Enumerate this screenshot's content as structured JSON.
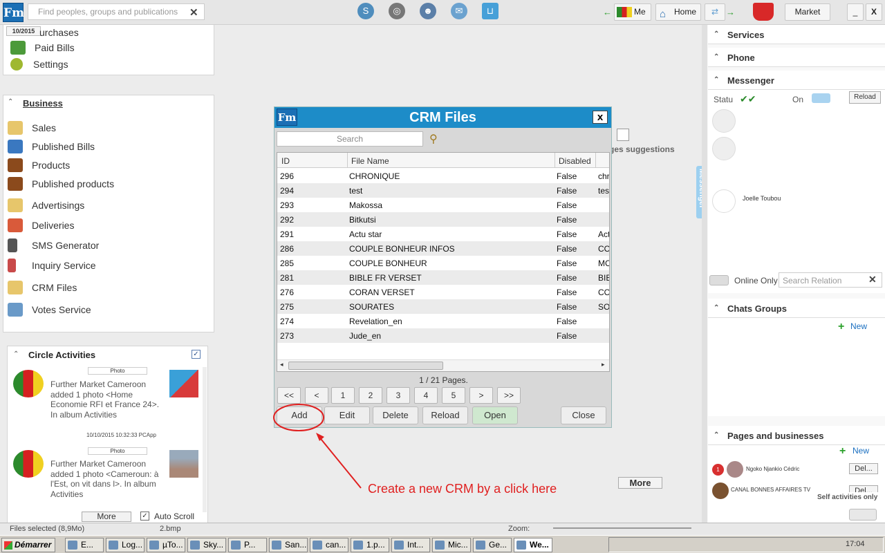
{
  "topbar": {
    "search_placeholder": "Find peoples, groups and publications",
    "me_label": "Me",
    "home_label": "Home",
    "market_label": "Market",
    "minimize_label": "_",
    "close_label": "X",
    "date_badge": "10/2015"
  },
  "left_top_menu": {
    "items": [
      {
        "label": "urchases"
      },
      {
        "label": "Paid Bills"
      },
      {
        "label": "Settings"
      }
    ]
  },
  "business": {
    "title": "Business",
    "items": [
      {
        "label": "Sales"
      },
      {
        "label": "Published Bills"
      },
      {
        "label": "Products"
      },
      {
        "label": "Published products"
      },
      {
        "label": "Advertisings"
      },
      {
        "label": "Deliveries"
      },
      {
        "label": "SMS Generator"
      },
      {
        "label": "Inquiry Service"
      },
      {
        "label": "CRM Files"
      },
      {
        "label": "Votes Service"
      }
    ]
  },
  "circle": {
    "title": "Circle Activities",
    "posts": [
      {
        "tag": "Photo",
        "text": "Further Market Cameroon added 1 photo <Home Economie RFI et France 24>. In album Activities",
        "time": "10/10/2015 10:32:33 PCApp"
      },
      {
        "tag": "Photo",
        "text": "Further Market Cameroon added 1 photo <Cameroun: à l'Est, on vit dans l>. In album Activities"
      }
    ],
    "more_label": "More",
    "autoscroll_label": "Auto Scroll"
  },
  "center": {
    "suggestions_label": "ges suggestions",
    "more_label": "More",
    "annotation": "Create a new CRM by a click here",
    "messenger_tab": "Messenger"
  },
  "crm": {
    "title": "CRM Files",
    "close_x": "x",
    "search_placeholder": "Search",
    "columns": [
      "ID",
      "File Name",
      "Disabled"
    ],
    "rows": [
      {
        "id": "296",
        "name": "CHRONIQUE",
        "disabled": "False",
        "extra": "chr"
      },
      {
        "id": "294",
        "name": "test",
        "disabled": "False",
        "extra": "tes"
      },
      {
        "id": "293",
        "name": "Makossa",
        "disabled": "False",
        "extra": ""
      },
      {
        "id": "292",
        "name": "Bitkutsi",
        "disabled": "False",
        "extra": ""
      },
      {
        "id": "291",
        "name": "Actu star",
        "disabled": "False",
        "extra": "Act"
      },
      {
        "id": "286",
        "name": "COUPLE BONHEUR INFOS",
        "disabled": "False",
        "extra": "CO"
      },
      {
        "id": "285",
        "name": "COUPLE BONHEUR",
        "disabled": "False",
        "extra": "MC"
      },
      {
        "id": "281",
        "name": "BIBLE FR VERSET",
        "disabled": "False",
        "extra": "BIB"
      },
      {
        "id": "276",
        "name": "CORAN VERSET",
        "disabled": "False",
        "extra": "CO"
      },
      {
        "id": "275",
        "name": "SOURATES",
        "disabled": "False",
        "extra": "SO"
      },
      {
        "id": "274",
        "name": "Revelation_en",
        "disabled": "False",
        "extra": ""
      },
      {
        "id": "273",
        "name": "Jude_en",
        "disabled": "False",
        "extra": ""
      }
    ],
    "page_info": "1 / 21 Pages.",
    "pager": [
      "<<",
      "<",
      "1",
      "2",
      "3",
      "4",
      "5",
      ">",
      ">>"
    ],
    "add_label": "Add",
    "edit_label": "Edit",
    "delete_label": "Delete",
    "reload_label": "Reload",
    "open_label": "Open",
    "close_label": "Close"
  },
  "right": {
    "services": "Services",
    "phone": "Phone",
    "messenger": "Messenger",
    "status_label": "Statu",
    "on_label": "On",
    "reload_label": "Reload",
    "contact_name": "Joelle Toubou",
    "online_only": "Online Only",
    "search_relation": "Search Relation",
    "chats_groups": "Chats Groups",
    "new_label": "New",
    "pages_businesses": "Pages and businesses",
    "pages_new_label": "New",
    "page1_name": "Ngoko Njankio Cédric",
    "page1_badge": "1",
    "page2_name": "CANAL BONNES AFFAIRES TV",
    "del_label": "Del...",
    "self_activities": "Self activities only"
  },
  "statusbar": {
    "files_selected": "Files selected (8,9Mo)",
    "file_name": "2.bmp",
    "zoom_label": "Zoom:"
  },
  "taskbar": {
    "start_label": "Démarrer",
    "tasks": [
      "E...",
      "Log...",
      "µTo...",
      "Sky...",
      "P...",
      "San...",
      "can...",
      "1.p...",
      "Int...",
      "Mic...",
      "Ge...",
      "We..."
    ],
    "clock": "17:04"
  },
  "colors": {
    "accent": "#1d8cc8",
    "annotation": "#e02020",
    "open_green": "#cfe8cf"
  }
}
